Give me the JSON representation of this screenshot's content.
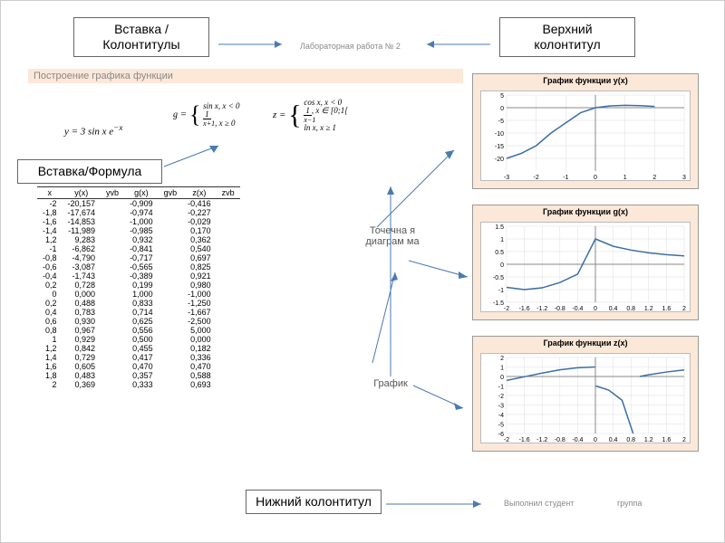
{
  "callouts": {
    "insert_header_footer": "Вставка /\nКолонтитулы",
    "insert_formula": "Вставка/Формула",
    "top_header": "Верхний\nколонтитул",
    "bottom_footer": "Нижний\nколонтитул"
  },
  "header": {
    "lab": "Лабораторная работа № 2"
  },
  "section_title": "Построение графика функции",
  "formulas": {
    "y": "y = 3 sin x e^{-x}",
    "g": "g = { sin x, x < 0 ; 1/(x+1), x ≥ 0 }",
    "z": "z = { cos x, x < 0 ; 1/(x−1), x ∈ [0;1[ ; ln x, x ≥ 1 }"
  },
  "table": {
    "headers": [
      "x",
      "y(x)",
      "yvb",
      "g(x)",
      "gvb",
      "z(x)",
      "zvb"
    ],
    "rows": [
      [
        "-2",
        "-20,157",
        "",
        "-0,909",
        "",
        "-0,416",
        ""
      ],
      [
        "-1,8",
        "-17,674",
        "",
        "-0,974",
        "",
        "-0,227",
        ""
      ],
      [
        "-1,6",
        "-14,853",
        "",
        "-1,000",
        "",
        "-0,029",
        ""
      ],
      [
        "-1,4",
        "-11,989",
        "",
        "-0,985",
        "",
        "0,170",
        ""
      ],
      [
        "1,2",
        "9,283",
        "",
        "0,932",
        "",
        "0,362",
        ""
      ],
      [
        "-1",
        "-6,862",
        "",
        "-0,841",
        "",
        "0,540",
        ""
      ],
      [
        "-0,8",
        "-4,790",
        "",
        "-0,717",
        "",
        "0,697",
        ""
      ],
      [
        "-0,6",
        "-3,087",
        "",
        "-0,565",
        "",
        "0,825",
        ""
      ],
      [
        "-0,4",
        "-1,743",
        "",
        "-0,389",
        "",
        "0,921",
        ""
      ],
      [
        "0,2",
        "0,728",
        "",
        "0,199",
        "",
        "0,980",
        ""
      ],
      [
        "0",
        "0,000",
        "",
        "1,000",
        "",
        "-1,000",
        ""
      ],
      [
        "0,2",
        "0,488",
        "",
        "0,833",
        "",
        "-1,250",
        ""
      ],
      [
        "0,4",
        "0,783",
        "",
        "0,714",
        "",
        "-1,667",
        ""
      ],
      [
        "0,6",
        "0,930",
        "",
        "0,625",
        "",
        "-2,500",
        ""
      ],
      [
        "0,8",
        "0,967",
        "",
        "0,556",
        "",
        "5,000",
        ""
      ],
      [
        "1",
        "0,929",
        "",
        "0,500",
        "",
        "0,000",
        ""
      ],
      [
        "1,2",
        "0,842",
        "",
        "0,455",
        "",
        "0,182",
        ""
      ],
      [
        "1,4",
        "0,729",
        "",
        "0,417",
        "",
        "0,336",
        ""
      ],
      [
        "1,6",
        "0,605",
        "",
        "0,470",
        "",
        "0,470",
        ""
      ],
      [
        "1,8",
        "0,483",
        "",
        "0,357",
        "",
        "0,588",
        ""
      ],
      [
        "2",
        "0,369",
        "",
        "0,333",
        "",
        "0,693",
        ""
      ]
    ]
  },
  "annotations": {
    "scatter": "Точечна\nя\nдиаграм\nма",
    "chart": "График"
  },
  "footer": {
    "performed": "Выполнил студент",
    "group": "группа"
  },
  "chart_data": [
    {
      "type": "line",
      "title": "График функции y(x)",
      "x": [
        -3,
        -2.5,
        -2,
        -1.5,
        -1,
        -0.5,
        0,
        0.5,
        1,
        1.5,
        2
      ],
      "y": [
        -20,
        -18,
        -15,
        -10,
        -6,
        -2,
        0,
        0.7,
        0.95,
        0.8,
        0.5
      ],
      "xlim": [
        -3,
        3
      ],
      "ylim": [
        -25,
        5
      ],
      "xticks": [
        -3,
        -2,
        -1,
        0,
        1,
        2,
        3
      ],
      "yticks": [
        -20,
        -15,
        -10,
        -5,
        0,
        5
      ]
    },
    {
      "type": "line",
      "title": "График функции g(x)",
      "x": [
        -2,
        -1.6,
        -1.2,
        -0.8,
        -0.4,
        0,
        0.4,
        0.8,
        1.2,
        1.6,
        2
      ],
      "y": [
        -0.91,
        -1.0,
        -0.93,
        -0.72,
        -0.39,
        1.0,
        0.71,
        0.56,
        0.45,
        0.38,
        0.33
      ],
      "xlim": [
        -2,
        2
      ],
      "ylim": [
        -1.5,
        1.5
      ],
      "xticks": [
        -2,
        -1.6,
        -1.2,
        -0.8,
        -0.4,
        0,
        0.4,
        0.8,
        1.2,
        1.6,
        2
      ],
      "yticks": [
        -1.5,
        -1.0,
        -0.5,
        0,
        0.5,
        1.0,
        1.5
      ]
    },
    {
      "type": "line",
      "title": "График функции z(x)",
      "series": [
        {
          "name": "neg",
          "x": [
            -2,
            -1.6,
            -1.2,
            -0.8,
            -0.4,
            -0.01
          ],
          "y": [
            -0.42,
            -0.03,
            0.36,
            0.7,
            0.92,
            1.0
          ]
        },
        {
          "name": "mid",
          "x": [
            0.01,
            0.3,
            0.6,
            0.85
          ],
          "y": [
            -1.0,
            -1.43,
            -2.5,
            -6
          ]
        },
        {
          "name": "pos",
          "x": [
            1.0,
            1.2,
            1.6,
            2.0
          ],
          "y": [
            0.0,
            0.18,
            0.47,
            0.69
          ]
        }
      ],
      "xlim": [
        -2,
        2
      ],
      "ylim": [
        -6,
        2
      ],
      "xticks": [
        -2,
        -1.6,
        -1.2,
        -0.8,
        -0.4,
        0,
        0.4,
        0.8,
        1.2,
        1.6,
        2
      ],
      "yticks": [
        -6,
        -5,
        -4,
        -3,
        -2,
        -1,
        0,
        1,
        2
      ]
    }
  ]
}
